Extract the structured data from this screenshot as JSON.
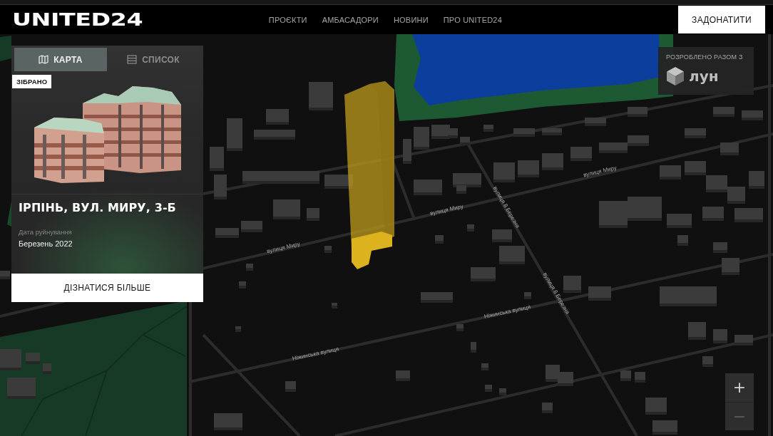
{
  "header": {
    "logo": "UNITED24",
    "nav": [
      {
        "label": "ПРОЄКТИ"
      },
      {
        "label": "АМБАСАДОРИ"
      },
      {
        "label": "НОВИНИ"
      },
      {
        "label": "ПРО UNITED24"
      }
    ],
    "donate_button": "ЗАДОНАТИТИ"
  },
  "panel": {
    "tabs": [
      {
        "label": "КАРТА",
        "selected": true
      },
      {
        "label": "СПИСОК",
        "selected": false
      }
    ],
    "badge": "ЗІБРАНО",
    "title": "ІРПІНЬ, ВУЛ. МИРУ, 3-Б",
    "date_label": "Дата руйнування",
    "date_value": "Березень 2022",
    "button": "ДІЗНАТИСЯ БІЛЬШЕ"
  },
  "partner": {
    "caption": "РОЗРОБЛЕНО РАЗОМ З",
    "logo_text": "лун"
  },
  "map": {
    "street_labels": [
      {
        "text": "вулиця Миру"
      },
      {
        "text": "вулиця 8 Березня"
      },
      {
        "text": "вулиця Миру"
      },
      {
        "text": "вулиця Миру"
      },
      {
        "text": "вулиця 8 Березня"
      },
      {
        "text": "Ніжинська вулиця"
      },
      {
        "text": "Ніжинська вулиця"
      }
    ],
    "zoom_controls": [
      {
        "label": "+",
        "disabled": false
      },
      {
        "label": "−",
        "disabled": true
      }
    ]
  }
}
